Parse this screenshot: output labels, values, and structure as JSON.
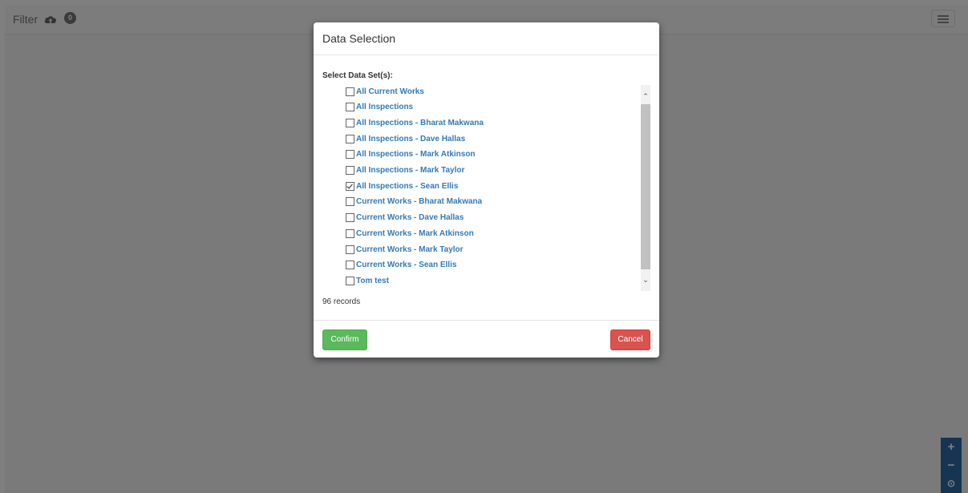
{
  "navbar": {
    "title": "Filter",
    "cloud_icon": "cloud-upload-icon",
    "badge_count": "0",
    "menu_icon": "hamburger-menu-icon"
  },
  "modal": {
    "title": "Data Selection",
    "select_label": "Select Data Set(s):",
    "items": [
      {
        "label": "All Current Works",
        "checked": false
      },
      {
        "label": "All Inspections",
        "checked": false
      },
      {
        "label": "All Inspections - Bharat Makwana",
        "checked": false
      },
      {
        "label": "All Inspections - Dave Hallas",
        "checked": false
      },
      {
        "label": "All Inspections - Mark Atkinson",
        "checked": false
      },
      {
        "label": "All Inspections - Mark Taylor",
        "checked": false
      },
      {
        "label": "All Inspections - Sean Ellis",
        "checked": true
      },
      {
        "label": "Current Works - Bharat Makwana",
        "checked": false
      },
      {
        "label": "Current Works - Dave Hallas",
        "checked": false
      },
      {
        "label": "Current Works - Mark Atkinson",
        "checked": false
      },
      {
        "label": "Current Works - Mark Taylor",
        "checked": false
      },
      {
        "label": "Current Works - Sean Ellis",
        "checked": false
      },
      {
        "label": "Tom test",
        "checked": false
      }
    ],
    "records": "96 records",
    "confirm_label": "Confirm",
    "cancel_label": "Cancel"
  },
  "zoom": {
    "zoom_in": "+",
    "zoom_out": "−",
    "locate": "⊙"
  },
  "colors": {
    "link": "#337ab7",
    "confirm": "#5cb85c",
    "cancel": "#d9534f",
    "zoom_bg": "#2c6aa7"
  }
}
